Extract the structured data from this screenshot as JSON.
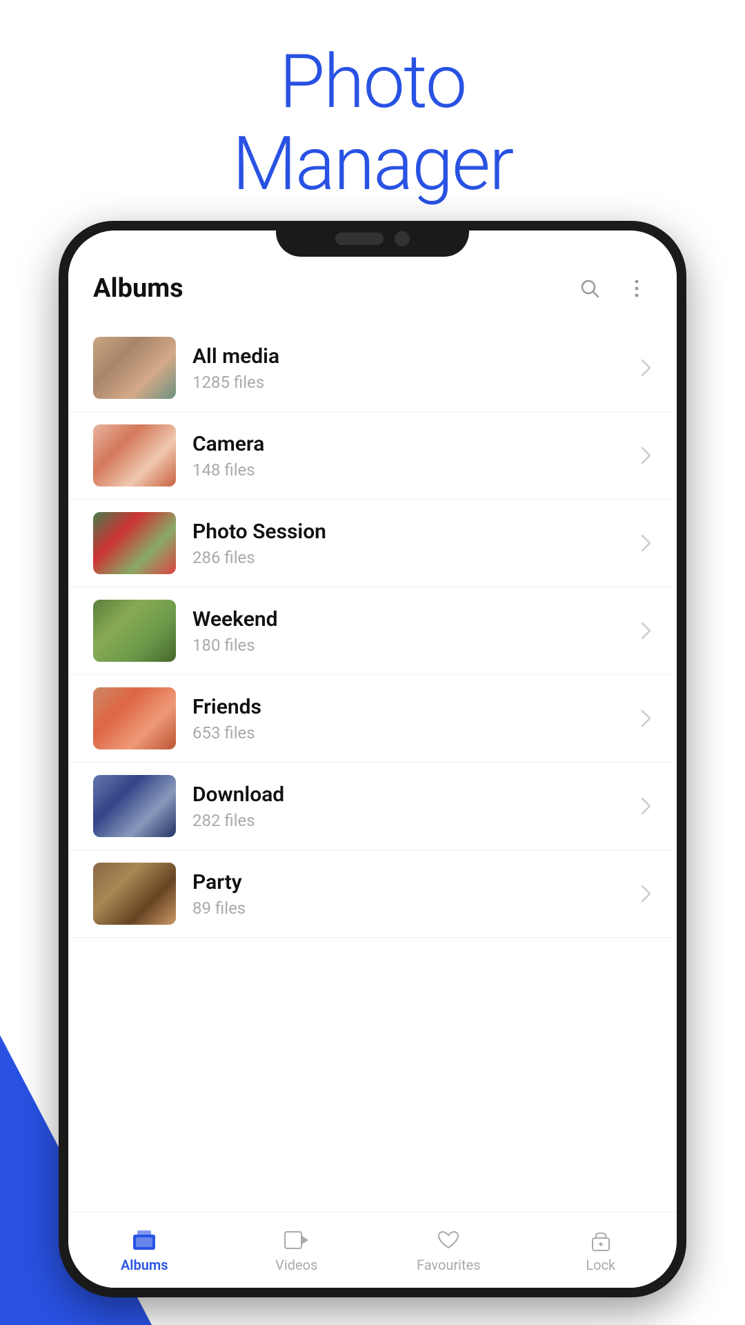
{
  "app": {
    "title": "Photo\nManager",
    "title_line1": "Photo",
    "title_line2": "Manager"
  },
  "header": {
    "title": "Albums",
    "search_icon": "search-icon",
    "more_icon": "more-options-icon"
  },
  "albums": [
    {
      "name": "All media",
      "count": "1285 files",
      "thumb_class": "thumb-1"
    },
    {
      "name": "Camera",
      "count": "148 files",
      "thumb_class": "thumb-2"
    },
    {
      "name": "Photo Session",
      "count": "286 files",
      "thumb_class": "thumb-3"
    },
    {
      "name": "Weekend",
      "count": "180 files",
      "thumb_class": "thumb-4"
    },
    {
      "name": "Friends",
      "count": "653 files",
      "thumb_class": "thumb-5"
    },
    {
      "name": "Download",
      "count": "282 files",
      "thumb_class": "thumb-6"
    },
    {
      "name": "Party",
      "count": "89 files",
      "thumb_class": "thumb-7"
    }
  ],
  "nav": {
    "items": [
      {
        "label": "Albums",
        "active": true
      },
      {
        "label": "Videos",
        "active": false
      },
      {
        "label": "Favourites",
        "active": false
      },
      {
        "label": "Lock",
        "active": false
      }
    ]
  },
  "colors": {
    "accent": "#2952e3"
  }
}
